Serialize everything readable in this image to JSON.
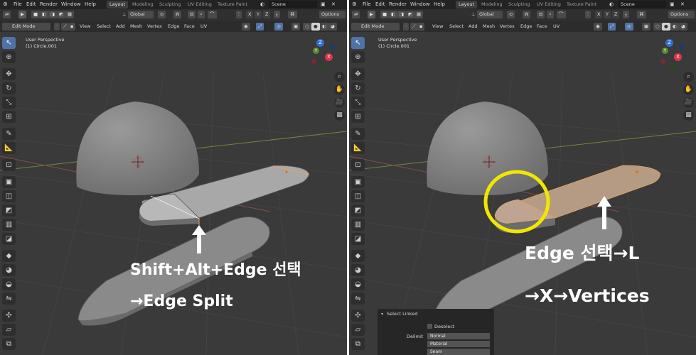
{
  "topbar": {
    "menu": [
      "File",
      "Edit",
      "Render",
      "Window",
      "Help"
    ],
    "workspaces": [
      "Layout",
      "Modeling",
      "Sculpting",
      "UV Editing",
      "Texture Paint"
    ],
    "scene": "Scene"
  },
  "header": {
    "transform": "Global",
    "axes": [
      "X",
      "Y",
      "Z"
    ],
    "options": "Options"
  },
  "editbar": {
    "mode": "Edit Mode",
    "menus": [
      "View",
      "Select",
      "Add",
      "Mesh",
      "Vertex",
      "Edge",
      "Face",
      "UV"
    ]
  },
  "viewport": {
    "perspective": "User Perspective",
    "object": "(1) Circle.001"
  },
  "gizmo": {
    "x": "X",
    "y": "Y",
    "z": "Z"
  },
  "captions": {
    "left_line1": "Shift+Alt+Edge 선택",
    "left_line2": "→Edge Split",
    "right_line1": "Edge 선택→L",
    "right_line2": "→X→Vertices"
  },
  "select_linked": {
    "title": "Select Linked",
    "deselect": "Deselect",
    "delimit_label": "Delimit",
    "delimit_options": [
      "Normal",
      "Material",
      "Seam"
    ]
  },
  "colors": {
    "viewport_bg": "#3a3a3a",
    "selection_orange": "#e8a25a",
    "highlight_circle": "#f2e600",
    "active_tool": "#4f73a8"
  }
}
